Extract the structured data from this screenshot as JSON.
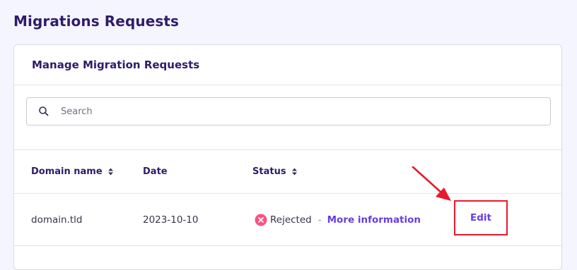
{
  "page": {
    "title": "Migrations Requests"
  },
  "card": {
    "title": "Manage Migration Requests"
  },
  "search": {
    "placeholder": "Search",
    "value": "",
    "icon": "search-icon"
  },
  "table": {
    "columns": [
      {
        "label": "Domain name",
        "sortable": true
      },
      {
        "label": "Date",
        "sortable": false
      },
      {
        "label": "Status",
        "sortable": true
      }
    ],
    "rows": [
      {
        "domain": "domain.tld",
        "date": "2023-10-10",
        "status": "Rejected",
        "status_icon": "x-circle-icon",
        "separator": "-",
        "more_info_label": "More information",
        "action_label": "Edit"
      }
    ]
  },
  "colors": {
    "accent": "#673de6",
    "title_text": "#2f1c6a",
    "rejected": "#fc5185",
    "annotation": "#e8192c"
  }
}
